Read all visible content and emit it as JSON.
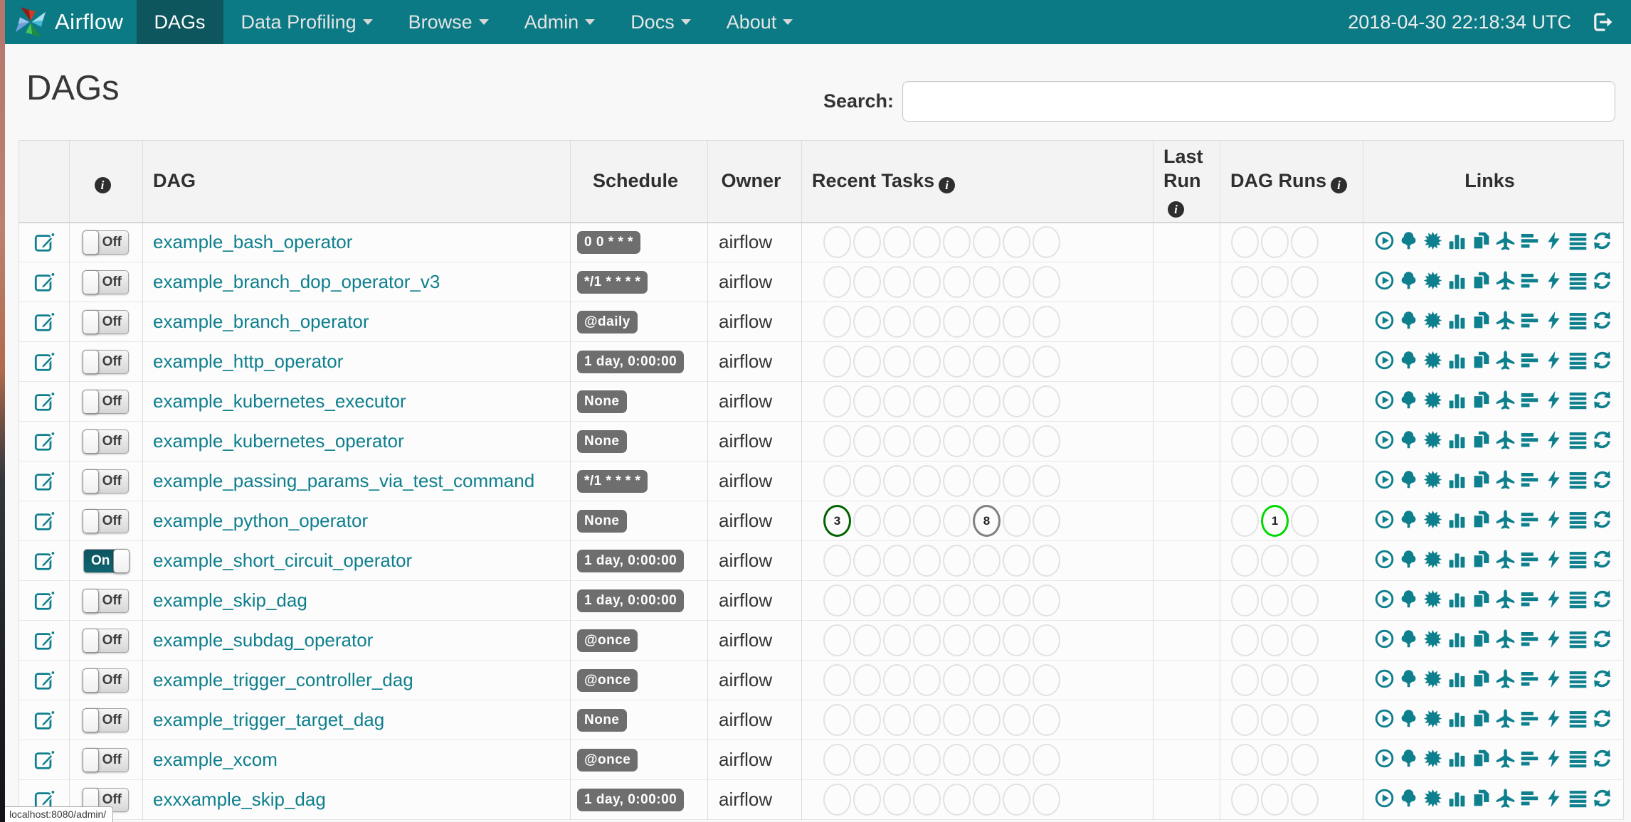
{
  "navbar": {
    "brand": "Airflow",
    "clock": "2018-04-30 22:18:34 UTC",
    "items": [
      {
        "id": "dags",
        "label": "DAGs",
        "active": true,
        "caret": false
      },
      {
        "id": "data-profiling",
        "label": "Data Profiling",
        "active": false,
        "caret": true
      },
      {
        "id": "browse",
        "label": "Browse",
        "active": false,
        "caret": true
      },
      {
        "id": "admin",
        "label": "Admin",
        "active": false,
        "caret": true
      },
      {
        "id": "docs",
        "label": "Docs",
        "active": false,
        "caret": true
      },
      {
        "id": "about",
        "label": "About",
        "active": false,
        "caret": true
      }
    ]
  },
  "page": {
    "title": "DAGs",
    "search_label": "Search:",
    "search_value": ""
  },
  "table": {
    "headers": {
      "dag": "DAG",
      "schedule": "Schedule",
      "owner": "Owner",
      "recent_tasks": "Recent Tasks",
      "last_run": "Last Run",
      "dag_runs": "DAG Runs",
      "links": "Links"
    },
    "recent_task_slots": 8,
    "dag_run_slots": 3,
    "link_icons": [
      {
        "id": "trigger-dag",
        "icon": "play-circle"
      },
      {
        "id": "tree-view",
        "icon": "tree"
      },
      {
        "id": "graph-view",
        "icon": "graph-burst"
      },
      {
        "id": "task-duration",
        "icon": "bar-chart"
      },
      {
        "id": "task-tries",
        "icon": "copy-pages"
      },
      {
        "id": "landing-times",
        "icon": "plane"
      },
      {
        "id": "gantt-view",
        "icon": "gantt-bars"
      },
      {
        "id": "code-view",
        "icon": "bolt"
      },
      {
        "id": "logs",
        "icon": "list-lines"
      },
      {
        "id": "refresh",
        "icon": "refresh-arrows"
      }
    ],
    "rows": [
      {
        "dag": "example_bash_operator",
        "toggle": "Off",
        "schedule": "0 0 * * *",
        "owner": "airflow",
        "recent_tasks": [],
        "dag_runs": []
      },
      {
        "dag": "example_branch_dop_operator_v3",
        "toggle": "Off",
        "schedule": "*/1 * * * *",
        "owner": "airflow",
        "recent_tasks": [],
        "dag_runs": []
      },
      {
        "dag": "example_branch_operator",
        "toggle": "Off",
        "schedule": "@daily",
        "owner": "airflow",
        "recent_tasks": [],
        "dag_runs": []
      },
      {
        "dag": "example_http_operator",
        "toggle": "Off",
        "schedule": "1 day, 0:00:00",
        "owner": "airflow",
        "recent_tasks": [],
        "dag_runs": []
      },
      {
        "dag": "example_kubernetes_executor",
        "toggle": "Off",
        "schedule": "None",
        "owner": "airflow",
        "recent_tasks": [],
        "dag_runs": []
      },
      {
        "dag": "example_kubernetes_operator",
        "toggle": "Off",
        "schedule": "None",
        "owner": "airflow",
        "recent_tasks": [],
        "dag_runs": []
      },
      {
        "dag": "example_passing_params_via_test_command",
        "toggle": "Off",
        "schedule": "*/1 * * * *",
        "owner": "airflow",
        "recent_tasks": [],
        "dag_runs": []
      },
      {
        "dag": "example_python_operator",
        "toggle": "Off",
        "schedule": "None",
        "owner": "airflow",
        "recent_tasks": [
          {
            "slot": 1,
            "count": "3",
            "color": "#006400"
          },
          {
            "slot": 6,
            "count": "8",
            "color": "#808080"
          }
        ],
        "dag_runs": [
          {
            "slot": 2,
            "count": "1",
            "color": "#00d900"
          }
        ]
      },
      {
        "dag": "example_short_circuit_operator",
        "toggle": "On",
        "schedule": "1 day, 0:00:00",
        "owner": "airflow",
        "recent_tasks": [],
        "dag_runs": []
      },
      {
        "dag": "example_skip_dag",
        "toggle": "Off",
        "schedule": "1 day, 0:00:00",
        "owner": "airflow",
        "recent_tasks": [],
        "dag_runs": []
      },
      {
        "dag": "example_subdag_operator",
        "toggle": "Off",
        "schedule": "@once",
        "owner": "airflow",
        "recent_tasks": [],
        "dag_runs": []
      },
      {
        "dag": "example_trigger_controller_dag",
        "toggle": "Off",
        "schedule": "@once",
        "owner": "airflow",
        "recent_tasks": [],
        "dag_runs": []
      },
      {
        "dag": "example_trigger_target_dag",
        "toggle": "Off",
        "schedule": "None",
        "owner": "airflow",
        "recent_tasks": [],
        "dag_runs": []
      },
      {
        "dag": "example_xcom",
        "toggle": "Off",
        "schedule": "@once",
        "owner": "airflow",
        "recent_tasks": [],
        "dag_runs": []
      },
      {
        "dag": "exxxample_skip_dag",
        "toggle": "Off",
        "schedule": "1 day, 0:00:00",
        "owner": "airflow",
        "recent_tasks": [],
        "dag_runs": []
      }
    ]
  },
  "status_bar": {
    "text": "localhost:8080/admin/"
  }
}
